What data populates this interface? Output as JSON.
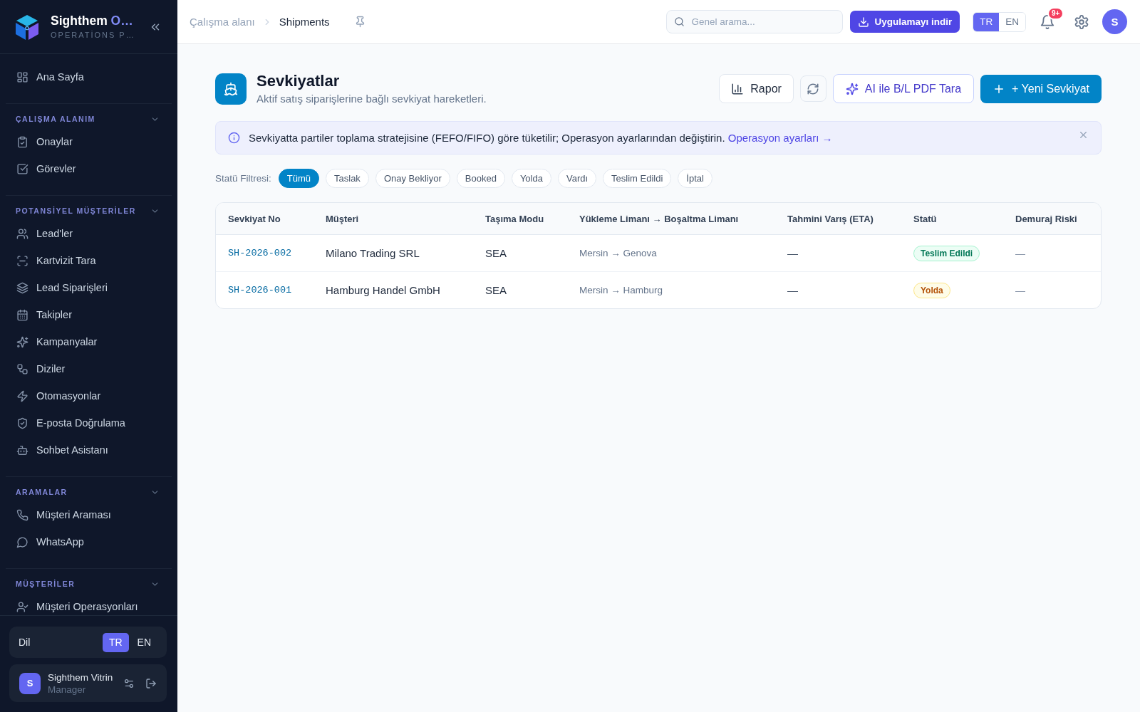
{
  "sidebar": {
    "brand": {
      "title": "Sighthem",
      "title_accent": "O…",
      "subtitle": "OPERATİONS P…"
    },
    "home_item": {
      "label": "Ana Sayfa"
    },
    "sections": [
      {
        "title": "ÇALIŞMA ALANIM",
        "expanded": true,
        "items": [
          {
            "label": "Onaylar"
          },
          {
            "label": "Görevler"
          }
        ]
      },
      {
        "title": "POTANSİYEL MÜŞTERİLER",
        "expanded": true,
        "items": [
          {
            "label": "Lead'ler"
          },
          {
            "label": "Kartvizit Tara"
          },
          {
            "label": "Lead Siparişleri"
          },
          {
            "label": "Takipler"
          },
          {
            "label": "Kampanyalar"
          },
          {
            "label": "Diziler"
          },
          {
            "label": "Otomasyonlar"
          },
          {
            "label": "E-posta Doğrulama"
          },
          {
            "label": "Sohbet Asistanı"
          }
        ]
      },
      {
        "title": "ARAMALAR",
        "expanded": true,
        "items": [
          {
            "label": "Müşteri Araması"
          },
          {
            "label": "WhatsApp"
          }
        ]
      },
      {
        "title": "MÜŞTERİLER",
        "expanded": true,
        "items": [
          {
            "label": "Müşteri Operasyonları"
          }
        ]
      }
    ],
    "language": {
      "label": "Dil",
      "options": [
        {
          "label": "TR",
          "selected": true
        },
        {
          "label": "EN",
          "selected": false
        }
      ]
    },
    "user": {
      "initial": "S",
      "name": "Sighthem Vitrin",
      "role": "Manager"
    }
  },
  "topbar": {
    "breadcrumb": [
      {
        "label": "Çalışma alanı"
      },
      {
        "label": "Shipments"
      }
    ],
    "search": {
      "placeholder": "Genel arama..."
    },
    "download_button": "Uygulamayı indir",
    "languages": [
      {
        "label": "TR",
        "selected": true
      },
      {
        "label": "EN",
        "selected": false
      }
    ],
    "notification_badge": "9+",
    "avatar": "S"
  },
  "page": {
    "title": "Sevkiyatlar",
    "subtitle": "Aktif satış siparişlerine bağlı sevkiyat hareketleri.",
    "report_button": "Rapor",
    "ai_scan_button": "AI ile B/L PDF Tara",
    "new_button": "+ Yeni Sevkiyat"
  },
  "banner": {
    "text": "Sevkiyatta partiler toplama stratejisine (FEFO/FIFO) göre tüketilir; Operasyon ayarlarından değiştirin.",
    "link": "Operasyon ayarları →"
  },
  "status_filter": {
    "label": "Statü Filtresi:",
    "options": [
      {
        "label": "Tümü",
        "selected": true
      },
      {
        "label": "Taslak",
        "selected": false
      },
      {
        "label": "Onay Bekliyor",
        "selected": false
      },
      {
        "label": "Booked",
        "selected": false
      },
      {
        "label": "Yolda",
        "selected": false
      },
      {
        "label": "Vardı",
        "selected": false
      },
      {
        "label": "Teslim Edildi",
        "selected": false
      },
      {
        "label": "İptal",
        "selected": false
      }
    ]
  },
  "table": {
    "columns": [
      "Sevkiyat No",
      "Müşteri",
      "Taşıma Modu",
      "Yükleme Limanı → Boşaltma Limanı",
      "Tahmini Varış (ETA)",
      "Statü",
      "Demuraj Riski"
    ],
    "rows": [
      {
        "shipment_no": "SH-2026-002",
        "customer": "Milano Trading SRL",
        "mode": "SEA",
        "route": "Mersin → Genova",
        "eta": "—",
        "status": {
          "label": "Teslim Edildi",
          "kind": "delivered"
        },
        "demurrage_risk": "—"
      },
      {
        "shipment_no": "SH-2026-001",
        "customer": "Hamburg Handel GmbH",
        "mode": "SEA",
        "route": "Mersin → Hamburg",
        "eta": "—",
        "status": {
          "label": "Yolda",
          "kind": "in_transit"
        },
        "demurrage_risk": "—"
      }
    ]
  }
}
